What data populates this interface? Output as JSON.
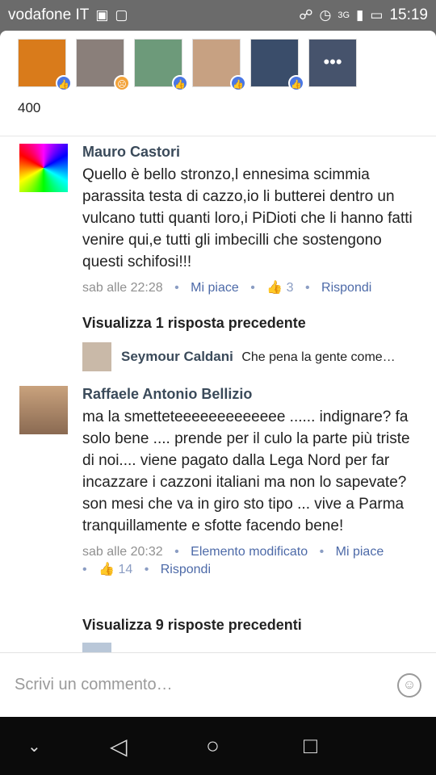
{
  "status": {
    "carrier": "vodafone IT",
    "time": "15:19",
    "left_icons": [
      "facebook-icon",
      "gallery-icon"
    ],
    "right_icons": [
      "headphones-icon",
      "alarm-icon",
      "signal-icon",
      "battery-icon"
    ],
    "network_label": "3G"
  },
  "reactions": {
    "count": "400",
    "thumbs": [
      {
        "name": "reactor-1",
        "badge": "like",
        "color": "#d97b1b"
      },
      {
        "name": "reactor-2",
        "badge": "angry",
        "color": "#8a7f7a"
      },
      {
        "name": "reactor-3",
        "badge": "like",
        "color": "#6d9a7a"
      },
      {
        "name": "reactor-4",
        "badge": "like",
        "color": "#c7a182"
      },
      {
        "name": "reactor-5",
        "badge": "like",
        "color": "#3a4d6a"
      },
      {
        "name": "reactor-6",
        "badge": "more",
        "color": "#46536c"
      }
    ]
  },
  "comments": [
    {
      "author": "Mauro Castori",
      "text": "Quello è bello stronzo,l ennesima scimmia parassita testa di cazzo,io li butterei dentro un vulcano tutti quanti loro,i PiDioti che li hanno fatti venire qui,e tutti gli imbecilli che sostengono questi schifosi!!!",
      "time": "sab alle 22:28",
      "like_label": "Mi piace",
      "likes": "3",
      "reply_label": "Rispondi",
      "replies_link": "Visualizza 1 risposta precedente",
      "reply": {
        "author": "Seymour Caldani",
        "text": "Che pena la gente come…"
      }
    },
    {
      "author": "Raffaele Antonio Bellizio",
      "text": "ma la smetteteeeeeeeeeeeee ...... indignare? fa solo bene .... prende per il culo la parte più triste di noi.... viene pagato dalla Lega Nord per far incazzare i cazzoni italiani ma non lo sapevate? son mesi che va in giro sto tipo ... vive a Parma tranquillamente e sfotte facendo bene!",
      "time": "sab alle 20:32",
      "edited_label": "Elemento modificato",
      "like_label": "Mi piace",
      "likes": "14",
      "reply_label": "Rispondi",
      "replies_link": "Visualizza 9 risposte precedenti"
    }
  ],
  "composer": {
    "placeholder": "Scrivi un commento…"
  }
}
